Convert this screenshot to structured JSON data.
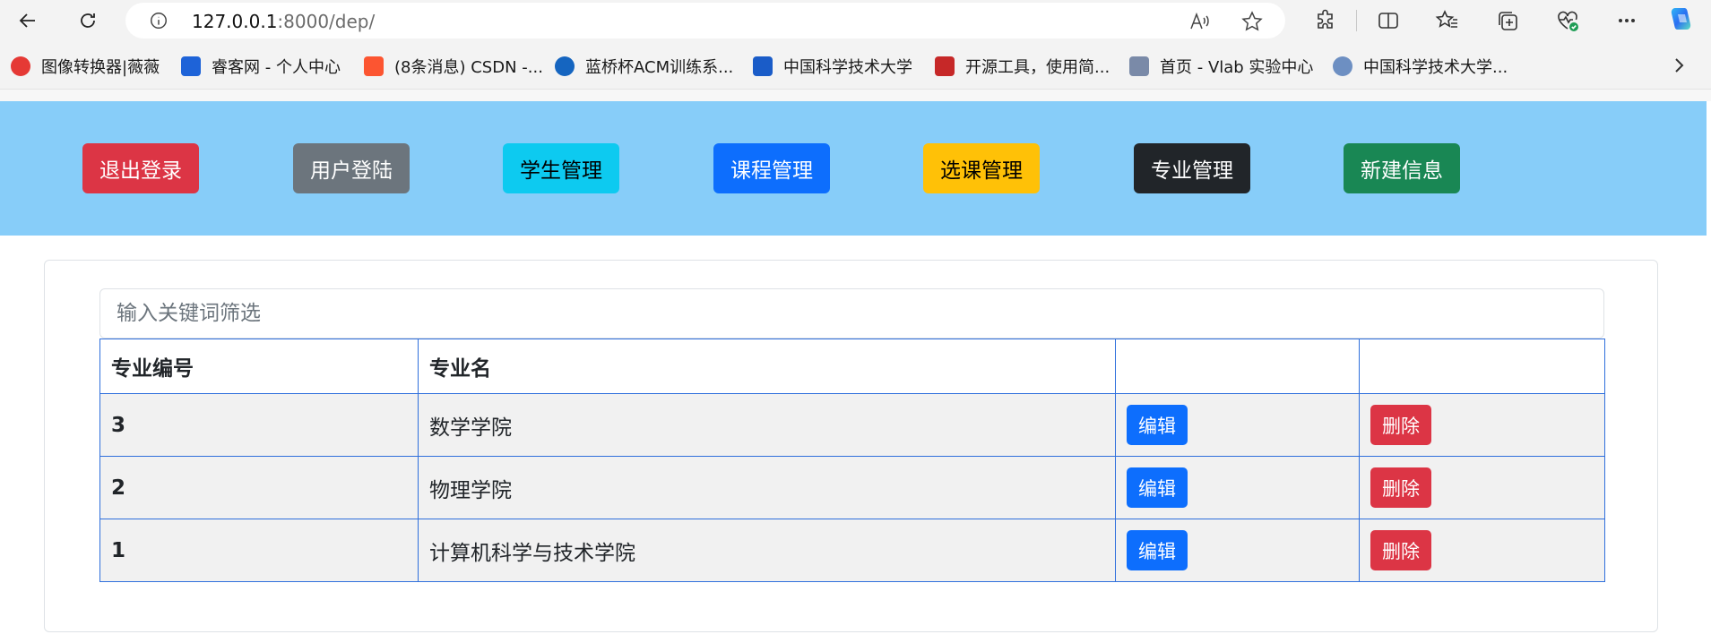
{
  "browser": {
    "url_host": "127.0.0.1",
    "url_rest": ":8000/dep/",
    "bookmarks": [
      {
        "label": "图像转换器|薇薇",
        "color": "#e53935"
      },
      {
        "label": "睿客网 - 个人中心",
        "color": "#1e63d8"
      },
      {
        "label": "(8条消息) CSDN -...",
        "color": "#fc5531"
      },
      {
        "label": "蓝桥杯ACM训练系...",
        "color": "#1565c0"
      },
      {
        "label": "中国科学技术大学",
        "color": "#1a5cc8"
      },
      {
        "label": "开源工具，使用简...",
        "color": "#c62828"
      },
      {
        "label": "首页 - Vlab 实验中心",
        "color": "#7a8aa8"
      },
      {
        "label": "中国科学技术大学...",
        "color": "#6d8fc2"
      }
    ]
  },
  "nav": {
    "logout": "退出登录",
    "login": "用户登陆",
    "students": "学生管理",
    "courses": "课程管理",
    "selection": "选课管理",
    "majors": "专业管理",
    "new_info": "新建信息"
  },
  "filter": {
    "placeholder": "输入关键词筛选",
    "value": ""
  },
  "table": {
    "headers": [
      "专业编号",
      "专业名",
      "",
      ""
    ],
    "rows": [
      {
        "id": "3",
        "name": "数学学院",
        "edit": "编辑",
        "delete": "删除"
      },
      {
        "id": "2",
        "name": "物理学院",
        "edit": "编辑",
        "delete": "删除"
      },
      {
        "id": "1",
        "name": "计算机科学与技术学院",
        "edit": "编辑",
        "delete": "删除"
      }
    ]
  },
  "colors": {
    "navbar_bg": "#87cdf9",
    "table_border": "#2f6fdc",
    "primary": "#0d6efd",
    "danger": "#dc3545"
  }
}
